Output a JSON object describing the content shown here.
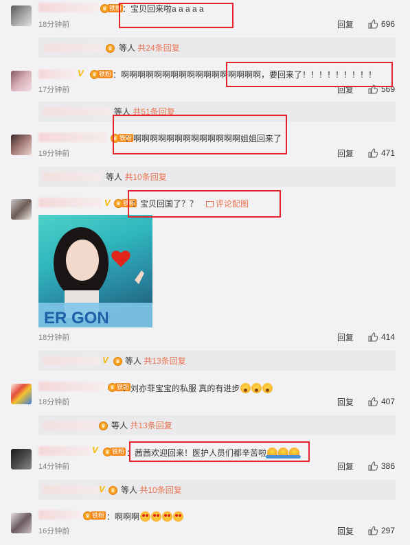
{
  "comments": [
    {
      "fan_label": "铁粉",
      "text": "宝贝回来啦a a a a a",
      "time": "18分钟前",
      "reply": "回复",
      "likes": "696",
      "replies": {
        "prefix": "等人",
        "count": "共24条回复"
      }
    },
    {
      "fan_label": "铁粉",
      "text": "啊啊啊啊啊啊啊啊啊啊啊啊啊啊啊啊啊，要回来了！！！！！！！！！",
      "time": "17分钟前",
      "reply": "回复",
      "likes": "569",
      "replies": {
        "prefix": "等人",
        "count": "共51条回复"
      }
    },
    {
      "fan_label": "铁粉",
      "text": "啊啊啊啊啊啊啊啊啊啊啊啊啊姐姐回来了",
      "time": "19分钟前",
      "reply": "回复",
      "likes": "471",
      "replies": {
        "prefix": "等人",
        "count": "共10条回复"
      }
    },
    {
      "fan_label": "铁粉",
      "text": "宝贝回国了？？",
      "image_link": "评论配图",
      "time": "18分钟前",
      "reply": "回复",
      "likes": "414",
      "replies": {
        "prefix": "等人",
        "count": "共13条回复"
      }
    },
    {
      "fan_label": "铁粉",
      "text": "刘亦菲宝宝的私服 真的有进步",
      "time": "18分钟前",
      "reply": "回复",
      "likes": "407",
      "replies": {
        "prefix": "等人",
        "count": "共13条回复"
      }
    },
    {
      "fan_label": "铁粉",
      "text": "茜茜欢迎回来！医护人员们都辛苦啦",
      "time": "14分钟前",
      "reply": "回复",
      "likes": "386",
      "replies": {
        "prefix": "等人",
        "count": "共10条回复"
      }
    },
    {
      "fan_label": "铁粉",
      "text": "啊啊啊",
      "time": "16分钟前",
      "reply": "回复",
      "likes": "297"
    }
  ],
  "photo_caption": "ER GON",
  "colors": {
    "highlight_box": "#e5212b",
    "reply_count": "#eb7350",
    "fan_badge": "#f48a1b",
    "verified": "#f6b800"
  }
}
